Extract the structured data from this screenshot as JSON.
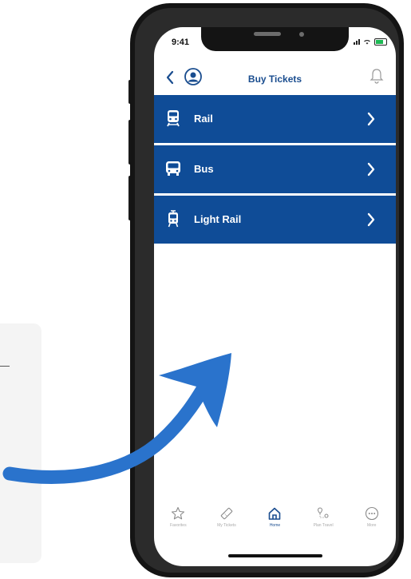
{
  "status": {
    "time": "9:41"
  },
  "header": {
    "title": "Buy Tickets"
  },
  "tickets": [
    {
      "label": "Rail",
      "icon": "train-icon"
    },
    {
      "label": "Bus",
      "icon": "bus-icon"
    },
    {
      "label": "Light Rail",
      "icon": "light-rail-icon"
    }
  ],
  "tabs": [
    {
      "label": "Favorites",
      "icon": "star-icon"
    },
    {
      "label": "My Tickets",
      "icon": "ticket-icon"
    },
    {
      "label": "Home",
      "icon": "home-icon",
      "active": true
    },
    {
      "label": "Plan Travel",
      "icon": "map-pin-icon"
    },
    {
      "label": "More",
      "icon": "more-icon"
    }
  ],
  "colors": {
    "primary": "#0f4c97",
    "title": "#1a4d8f",
    "arrow": "#2a73cc"
  }
}
